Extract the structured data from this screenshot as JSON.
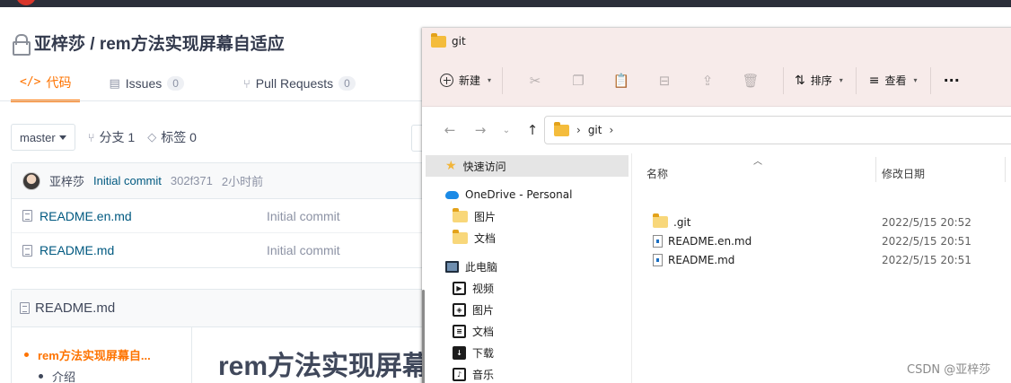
{
  "repo": {
    "title": "亚梓莎 / rem方法实现屏幕自适应",
    "tabs": [
      {
        "label": "代码",
        "icon": "code-icon"
      },
      {
        "label": "Issues",
        "badge": "0",
        "icon": "issues-icon"
      },
      {
        "label": "Pull Requests",
        "badge": "0",
        "icon": "pull-request-icon"
      }
    ],
    "branch": "master",
    "branches": "分支 1",
    "tags": "标签 0",
    "commit": {
      "author": "亚梓莎",
      "message": "Initial commit",
      "hash": "302f371",
      "time": "2小时前"
    },
    "files": [
      {
        "name": "README.en.md",
        "commit": "Initial commit"
      },
      {
        "name": "README.md",
        "commit": "Initial commit"
      }
    ],
    "readme": {
      "filename": "README.md",
      "toc": [
        {
          "label": "rem方法实现屏幕自..."
        },
        {
          "label": "介绍"
        }
      ],
      "heading": "rem方法实现屏幕自适应"
    }
  },
  "explorer": {
    "title": "git",
    "toolbar": {
      "new_label": "新建",
      "sort_label": "排序",
      "view_label": "查看",
      "more": "···"
    },
    "address": [
      "git"
    ],
    "nav": {
      "quick_access": "快速访问",
      "onedrive": "OneDrive - Personal",
      "onedrive_children": [
        "图片",
        "文档"
      ],
      "this_pc": "此电脑",
      "pc_children": [
        {
          "label": "视频",
          "icon": "video-library-icon"
        },
        {
          "label": "图片",
          "icon": "pictures-library-icon"
        },
        {
          "label": "文档",
          "icon": "documents-library-icon"
        },
        {
          "label": "下载",
          "icon": "downloads-library-icon"
        },
        {
          "label": "音乐",
          "icon": "music-library-icon"
        }
      ]
    },
    "columns": {
      "name": "名称",
      "modified": "修改日期"
    },
    "files": [
      {
        "name": ".git",
        "type": "folder",
        "modified": "2022/5/15 20:52"
      },
      {
        "name": "README.en.md",
        "type": "file",
        "modified": "2022/5/15 20:51"
      },
      {
        "name": "README.md",
        "type": "file",
        "modified": "2022/5/15 20:51"
      }
    ]
  },
  "watermark": "CSDN @亚梓莎",
  "colors": {
    "accent": "#fe7300",
    "link": "#005980",
    "explorer_chrome": "#f7ebea"
  }
}
